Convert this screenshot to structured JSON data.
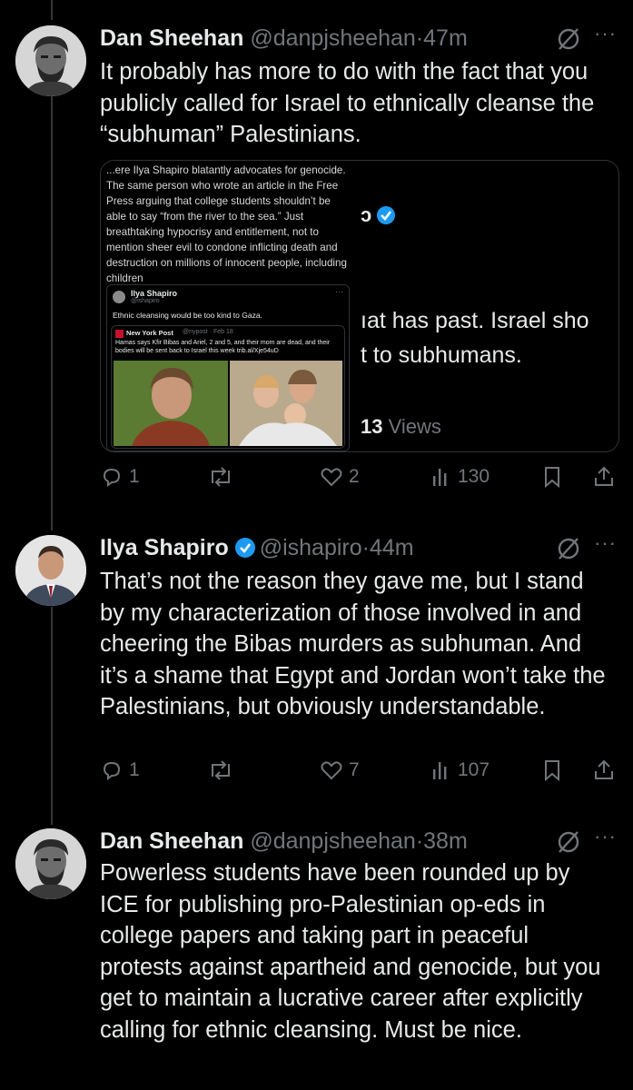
{
  "colors": {
    "background": "#000000",
    "text": "#e7e9ea",
    "muted": "#71767b",
    "verified": "#1d9bf0",
    "border": "#2f3336"
  },
  "tweets": [
    {
      "name": "Dan Sheehan",
      "handle": "@danpjsheehan",
      "time": "·47m",
      "text": "It probably has more to do with the fact that you publicly called for Israel to ethnically cleanse the “subhuman” Palestinians.",
      "replies": "1",
      "reposts": "",
      "likes": "2",
      "views": "130",
      "quote": {
        "image_text": "...ere Ilya Shapiro blatantly advocates for genocide.  The same person who wrote an article in the Free Press arguing that college students shouldn’t be able to say “from the river to the sea.” Just breathtaking hypocrisy and entitlement, not to mention sheer evil to condone inflicting death and destruction on millions of innocent people, including children",
        "inner_name": "Ilya Shapiro",
        "inner_handle": "@ishapiro",
        "inner_text": "Ethnic cleansing would be too kind to Gaza.",
        "nyp_name": "New York Post",
        "nyp_meta": "@nypost · Feb 18",
        "nyp_text": "Hamas says Kfir Bibas and Ariel, 2 and 5, and their mom are dead, and their bodies will be sent back to Israel this week trib.al/Xje54uD",
        "right_line1": "ıat has past. Israel sho",
        "right_line2": "t to subhumans.",
        "views_num": "13",
        "views_label": "Views"
      }
    },
    {
      "name": "Ilya Shapiro",
      "handle": "@ishapiro",
      "time": "·44m",
      "text": "That’s not the reason they gave me, but I stand by my characterization of those involved in and cheering the Bibas murders as subhuman. And it’s a shame that Egypt and Jordan won’t take the Palestinians, but obviously understandable.",
      "replies": "1",
      "reposts": "",
      "likes": "7",
      "views": "107"
    },
    {
      "name": "Dan Sheehan",
      "handle": "@danpjsheehan",
      "time": "·38m",
      "text": "Powerless students have been rounded up by ICE for publishing pro-Palestinian op-eds in college papers and taking part in peaceful protests against apartheid and genocide, but you get to maintain a lucrative career after explicitly calling for ethnic cleansing. Must be nice."
    }
  ],
  "icons": {
    "more": "more-icon",
    "grok": "grok-icon",
    "reply": "reply-icon",
    "repost": "repost-icon",
    "like": "like-icon",
    "views": "views-icon",
    "bookmark": "bookmark-icon",
    "share": "share-icon"
  }
}
